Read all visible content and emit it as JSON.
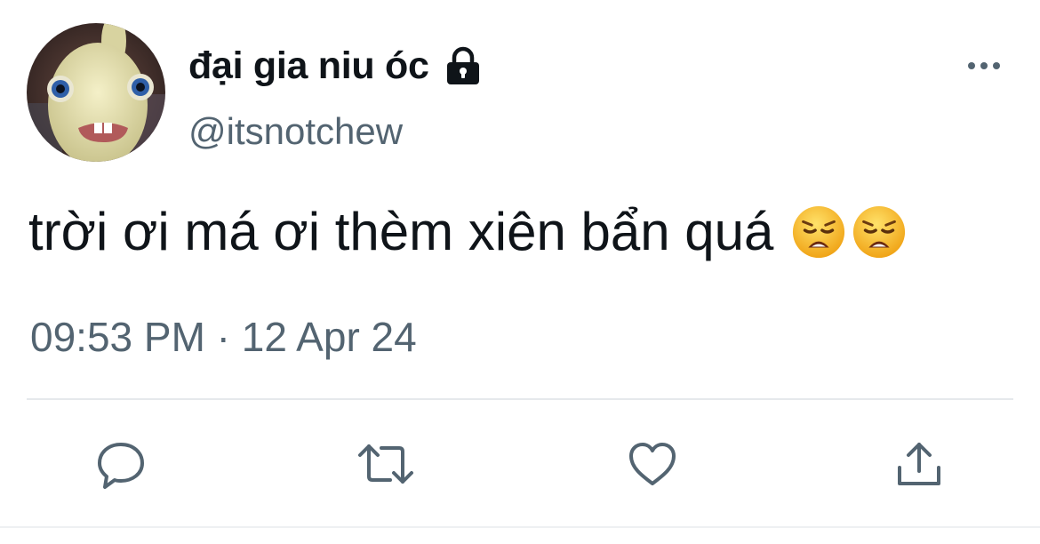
{
  "user": {
    "display_name": "đại gia niu óc",
    "handle": "@itsnotchew",
    "avatar_icon": "rabbid-avatar",
    "lock_icon": "lock-icon"
  },
  "tweet": {
    "text": "trời ơi má ơi thèm xiên bẩn quá",
    "emojis": [
      "weary-face-emoji",
      "weary-face-emoji"
    ],
    "timestamp": "09:53 PM · 12 Apr 24"
  },
  "actions": {
    "reply_icon": "reply-icon",
    "retweet_icon": "retweet-icon",
    "like_icon": "heart-icon",
    "share_icon": "share-icon",
    "more_icon": "more-dots-icon"
  },
  "colors": {
    "primary_text": "#0f1419",
    "secondary_text": "#536471",
    "divider": "#e6e9ec"
  }
}
